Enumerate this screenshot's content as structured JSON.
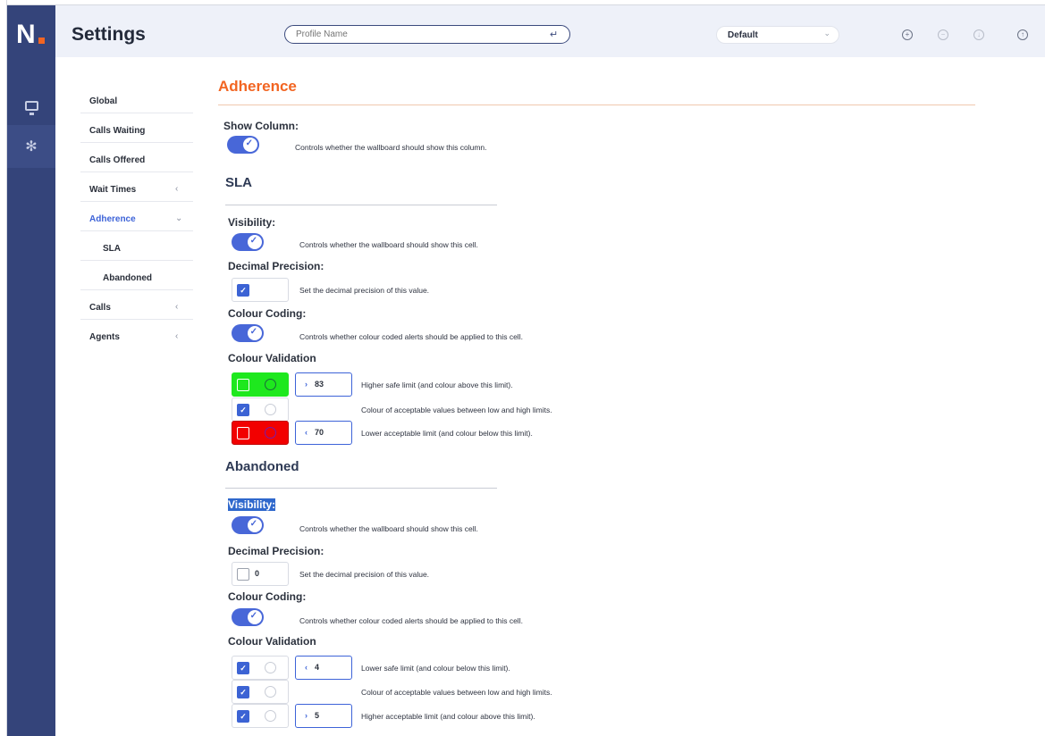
{
  "app": {
    "logo": "N",
    "title": "Settings",
    "brand_accent": "#f26522",
    "rail_color": "#34447a",
    "primary_blue": "#4867d8"
  },
  "topbar": {
    "profile_placeholder": "Profile Name",
    "profile_select_value": "Default",
    "icons": [
      "plus-circle-icon",
      "minus-circle-icon",
      "download-circle-icon",
      "upload-circle-icon"
    ]
  },
  "rail": {
    "items": [
      {
        "icon": "monitor-icon"
      },
      {
        "icon": "gear-icon",
        "active": true
      }
    ]
  },
  "sidebar": {
    "items": [
      {
        "label": "Global"
      },
      {
        "label": "Calls Waiting"
      },
      {
        "label": "Calls Offered"
      },
      {
        "label": "Wait Times",
        "chevron": "‹"
      },
      {
        "label": "Adherence",
        "chevron": "⌄",
        "active": true
      },
      {
        "label": "SLA",
        "sub": true
      },
      {
        "label": "Abandoned",
        "sub": true
      },
      {
        "label": "Calls",
        "chevron": "‹"
      },
      {
        "label": "Agents",
        "chevron": "‹"
      }
    ]
  },
  "main": {
    "heading": "Adherence",
    "show_column": {
      "label": "Show Column:",
      "enabled": true,
      "desc": "Controls whether the wallboard should show this column."
    },
    "sla": {
      "heading": "SLA",
      "visibility_label": "Visibility:",
      "visibility_desc": "Controls whether the wallboard should show this cell.",
      "decimal_label": "Decimal Precision:",
      "decimal_checked": true,
      "decimal_desc": "Set the decimal precision of this value.",
      "colour_coding_label": "Colour Coding:",
      "colour_coding_desc": "Controls whether colour coded alerts should be applied to this cell.",
      "colour_validation_label": "Colour Validation",
      "rows": [
        {
          "colour": "#1ee81e",
          "checked": false,
          "limit_symbol": "›",
          "limit": "83",
          "desc": "Higher safe limit (and colour above this limit)."
        },
        {
          "colour": "#ffffff",
          "checked": true,
          "desc": "Colour of acceptable values between low and high limits."
        },
        {
          "colour": "#f20000",
          "checked": false,
          "limit_symbol": "‹",
          "limit": "70",
          "desc": "Lower acceptable limit (and colour below this limit)."
        }
      ]
    },
    "abandoned": {
      "heading": "Abandoned",
      "visibility_label": "Visibility:",
      "visibility_desc": "Controls whether the wallboard should show this cell.",
      "decimal_label": "Decimal Precision:",
      "decimal_checked": false,
      "decimal_value": "0",
      "decimal_desc": "Set the decimal precision of this value.",
      "colour_coding_label": "Colour Coding:",
      "colour_coding_desc": "Controls whether colour coded alerts should be applied to this cell.",
      "colour_validation_label": "Colour Validation",
      "rows": [
        {
          "checked": true,
          "limit_symbol": "‹",
          "limit": "4",
          "desc": "Lower safe limit (and colour below this limit)."
        },
        {
          "checked": true,
          "desc": "Colour of acceptable values between low and high limits."
        },
        {
          "checked": true,
          "limit_symbol": "›",
          "limit": "5",
          "desc": "Higher acceptable limit (and colour above this limit)."
        }
      ]
    }
  }
}
